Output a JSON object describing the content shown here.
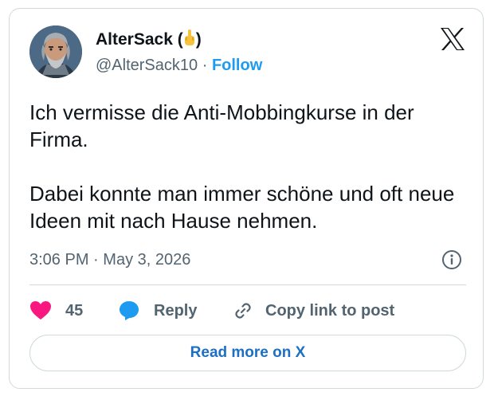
{
  "author": {
    "display_name": "AlterSack",
    "handle": "@AlterSack10",
    "separator": "·",
    "follow_label": "Follow",
    "name_suffix_open": "(",
    "name_suffix_close": ")",
    "emoji_icon": "middle-finger-emoji-icon"
  },
  "platform_icon": "x-logo-icon",
  "tweet": {
    "text_line1": "Ich vermisse die Anti-Mobbingkurse in der Firma.",
    "text_line2": "Dabei konnte man immer schöne und oft neue Ideen mit nach Hause nehmen.",
    "time": "3:06 PM",
    "date": "May 3, 2026",
    "meta_separator": "·"
  },
  "actions": {
    "likes_count": "45",
    "reply_label": "Reply",
    "copy_link_label": "Copy link to post"
  },
  "read_more_label": "Read more on X",
  "colors": {
    "accent": "#1d9bf0",
    "like": "#f91880",
    "text": "#0f1419",
    "muted": "#536471",
    "border": "#cfd9de"
  }
}
